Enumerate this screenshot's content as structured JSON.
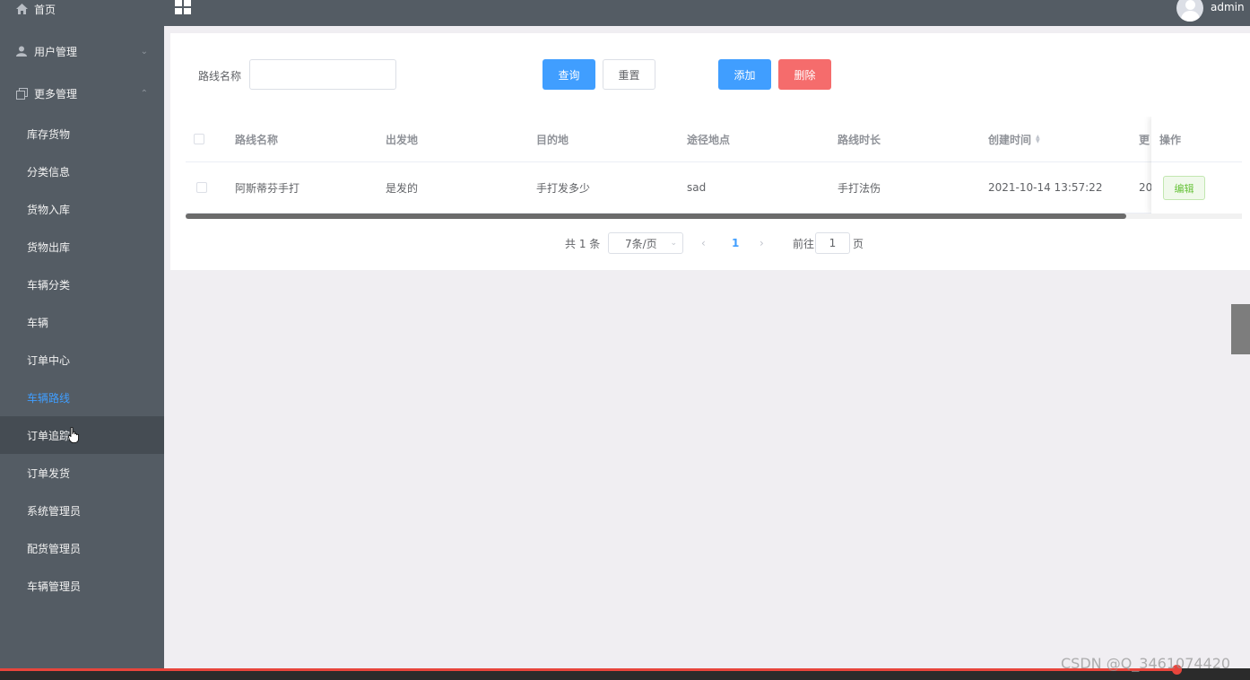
{
  "sidebar": {
    "items": [
      {
        "label": "首页"
      },
      {
        "label": "用户管理",
        "arrow": "⌄"
      },
      {
        "label": "更多管理",
        "arrow": "⌃"
      },
      {
        "label": "库存货物"
      },
      {
        "label": "分类信息"
      },
      {
        "label": "货物入库"
      },
      {
        "label": "货物出库"
      },
      {
        "label": "车辆分类"
      },
      {
        "label": "车辆"
      },
      {
        "label": "订单中心"
      },
      {
        "label": "车辆路线"
      },
      {
        "label": "订单追踪"
      },
      {
        "label": "订单发货"
      },
      {
        "label": "系统管理员"
      },
      {
        "label": "配货管理员"
      },
      {
        "label": "车辆管理员"
      }
    ],
    "active_item": "车辆路线",
    "hovered_item": "订单追踪",
    "colors": {
      "background": "#545c64",
      "active": "#409eff"
    }
  },
  "header": {
    "username": "admin",
    "menu_icon": "grid-icon"
  },
  "search": {
    "label": "路线名称",
    "value": "",
    "placeholder": ""
  },
  "toolbar": {
    "query_label": "查询",
    "reset_label": "重置",
    "add_label": "添加",
    "delete_label": "删除"
  },
  "table": {
    "columns": [
      "路线名称",
      "出发地",
      "目的地",
      "途径地点",
      "路线时长",
      "创建时间",
      "更新时间",
      "操作"
    ],
    "visible_truncated_column": "更",
    "rows": [
      {
        "route_name": "阿斯蒂芬手打",
        "origin": "是发的",
        "destination": "手打发多少",
        "via": "sad",
        "duration": "手打法伤",
        "created_at": "2021-10-14 13:57:22",
        "updated_at_visible": "20",
        "action_label": "编辑"
      }
    ]
  },
  "pagination": {
    "total_text": "共 1 条",
    "page_size_text": "7条/页",
    "current_page": "1",
    "goto_label": "前往",
    "goto_value": "1",
    "page_unit": "页"
  },
  "watermark": "CSDN @Q_3461074420"
}
